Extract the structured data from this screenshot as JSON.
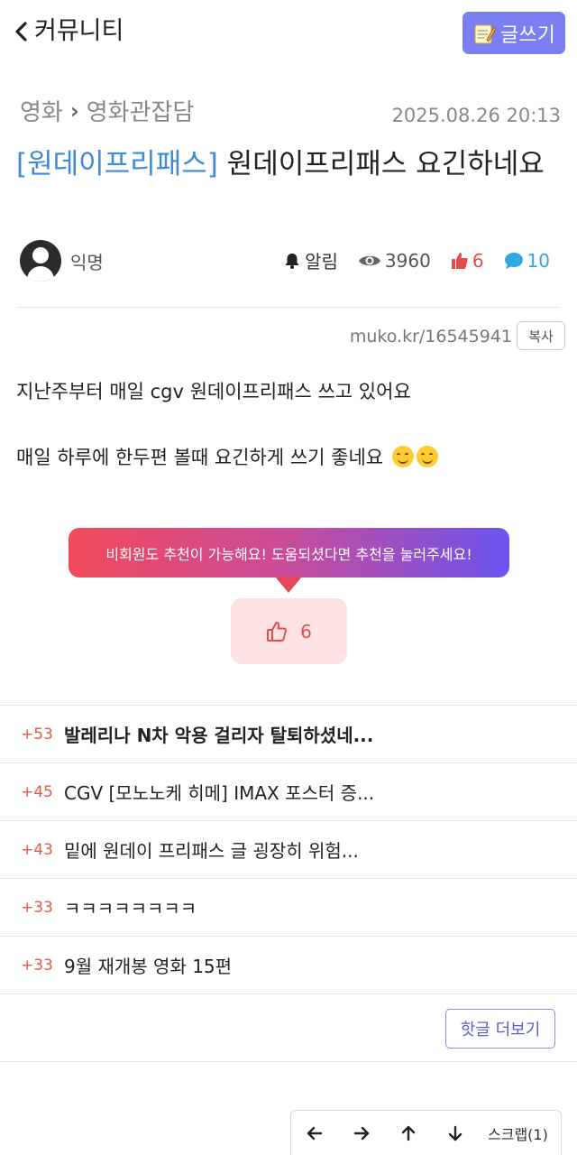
{
  "header": {
    "back_label": "커뮤니티",
    "write_label": "글쓰기"
  },
  "breadcrumb": {
    "category": "영화",
    "board": "영화관잡담"
  },
  "post": {
    "date": "2025.08.26 20:13",
    "title_tag": "[원데이프리패스]",
    "title_text": " 원데이프리패스 요긴하네요",
    "author": "익명",
    "alarm_label": "알림",
    "views": "3960",
    "likes": "6",
    "comments": "10",
    "url": "muko.kr/16545941",
    "copy_label": "복사",
    "body_line1": "지난주부터 매일 cgv 원데이프리패스 쓰고 있어요",
    "body_line2": "매일 하루에 한두편 볼때 요긴하게 쓰기 좋네요"
  },
  "recommend": {
    "tooltip": "비회원도 추천이 가능해요! 도움되셨다면 추천을 눌러주세요!",
    "count": "6"
  },
  "hot_posts": [
    {
      "score": "+53",
      "title": "발레리나 N차 악용 걸리자 탈퇴하셨네..."
    },
    {
      "score": "+45",
      "title": "CGV [모노노케 히메] IMAX 포스터 증..."
    },
    {
      "score": "+43",
      "title": "밑에 원데이 프리패스 글 굉장히 위험..."
    },
    {
      "score": "+33",
      "title": "ㅋㅋㅋㅋㅋㅋㅋㅋ"
    },
    {
      "score": "+33",
      "title": "9월 재개봉 영화 15편"
    }
  ],
  "hot_more_label": "핫글 더보기",
  "bottom_nav": {
    "scrap_label": "스크랩(1)"
  },
  "colors": {
    "accent": "#7b7ef0",
    "tag_blue": "#3d8ad8",
    "like_red": "#e64c4c",
    "comment_blue": "#2fa7e0"
  }
}
